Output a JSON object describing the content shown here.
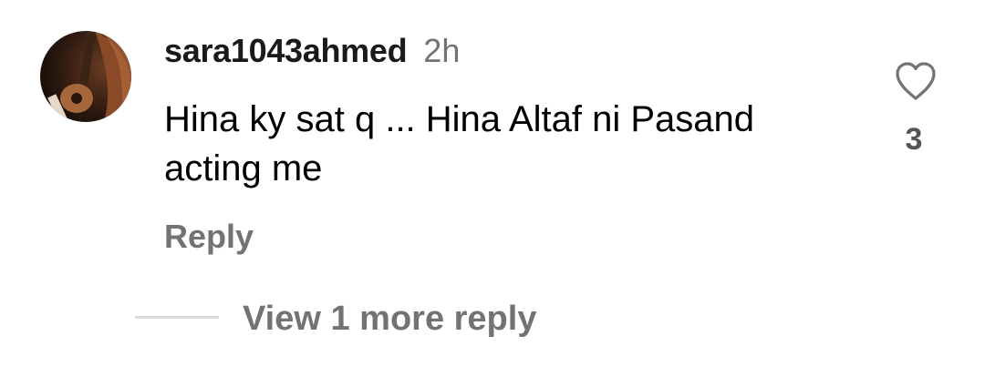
{
  "comment": {
    "username": "sara1043ahmed",
    "timestamp": "2h",
    "text": "Hina ky sat q ... Hina Altaf ni Pasand acting me",
    "reply_label": "Reply",
    "like_count": "3",
    "like_icon": "heart-outline-icon"
  },
  "replies": {
    "view_more_label": "View 1 more reply"
  },
  "colors": {
    "text_primary": "#000000",
    "text_secondary": "#737373",
    "divider": "#dbdbdb",
    "icon_stroke": "#737373"
  }
}
